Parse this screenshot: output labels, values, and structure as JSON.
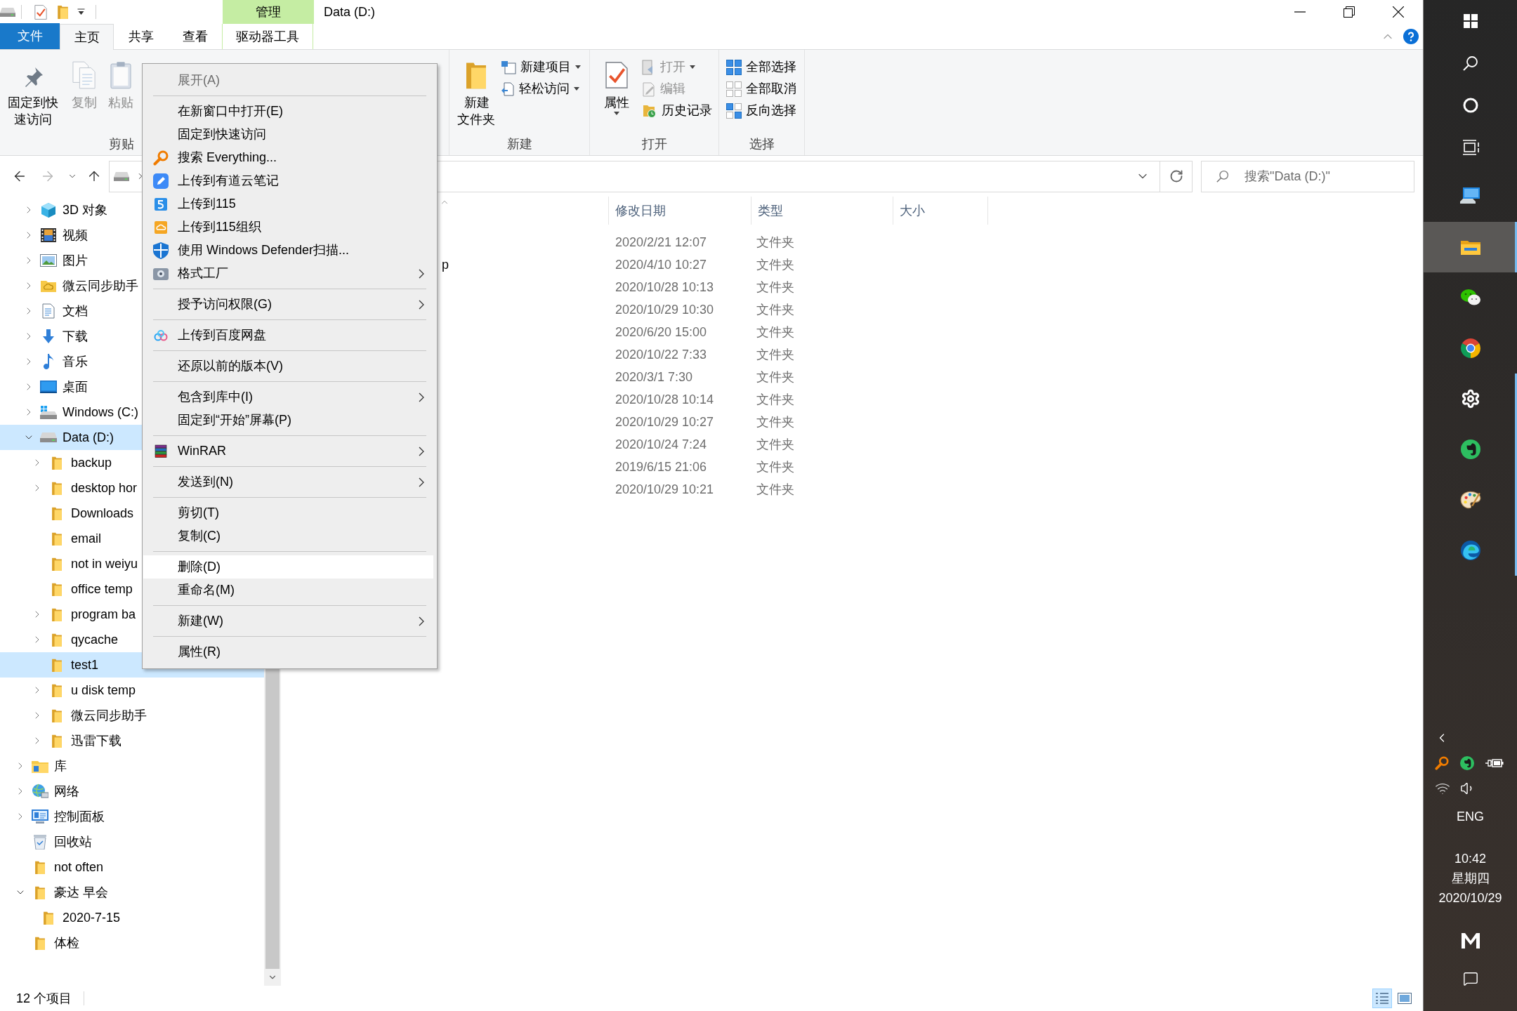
{
  "title_bar": {
    "contextual_group": "管理",
    "title": "Data (D:)"
  },
  "ribbon_tabs": [
    {
      "label": "文件",
      "kind": "file_menu",
      "selected": false
    },
    {
      "label": "主页",
      "kind": "tab",
      "selected": true
    },
    {
      "label": "共享",
      "kind": "tab",
      "selected": false
    },
    {
      "label": "查看",
      "kind": "tab",
      "selected": false
    },
    {
      "label": "驱动器工具",
      "kind": "contextual",
      "selected": false
    }
  ],
  "ribbon": {
    "groups": [
      {
        "label": "剪贴",
        "large_buttons": [
          {
            "label": "固定到快速访问",
            "disabled": false,
            "dropdown": false
          },
          {
            "label": "复制",
            "disabled": true,
            "dropdown": false
          },
          {
            "label": "粘贴",
            "disabled": true,
            "dropdown": false
          }
        ]
      },
      {
        "label": "新建",
        "large_buttons": [
          {
            "label": "新建文件夹",
            "disabled": false,
            "dropdown": false
          }
        ],
        "small_buttons": [
          {
            "label": "新建项目",
            "disabled": false,
            "dropdown": true
          },
          {
            "label": "轻松访问",
            "disabled": false,
            "dropdown": true
          }
        ]
      },
      {
        "label": "打开",
        "large_buttons": [
          {
            "label": "属性",
            "disabled": false,
            "dropdown": true
          }
        ],
        "small_buttons": [
          {
            "label": "打开",
            "disabled": true,
            "dropdown": true
          },
          {
            "label": "编辑",
            "disabled": true,
            "dropdown": false
          },
          {
            "label": "历史记录",
            "disabled": false,
            "dropdown": false
          }
        ]
      },
      {
        "label": "选择",
        "small_buttons": [
          {
            "label": "全部选择",
            "disabled": false,
            "dropdown": false
          },
          {
            "label": "全部取消",
            "disabled": false,
            "dropdown": false
          },
          {
            "label": "反向选择",
            "disabled": false,
            "dropdown": false
          }
        ]
      }
    ]
  },
  "search": {
    "placeholder": "搜索\"Data (D:)\""
  },
  "nav_pane": {
    "items": [
      {
        "label": "3D 对象",
        "kind": "branch",
        "expanded": false,
        "selected": false
      },
      {
        "label": "视频",
        "kind": "branch",
        "expanded": false,
        "selected": false
      },
      {
        "label": "图片",
        "kind": "branch",
        "expanded": false,
        "selected": false
      },
      {
        "label": "微云同步助手",
        "kind": "branch",
        "expanded": false,
        "selected": false
      },
      {
        "label": "文档",
        "kind": "branch",
        "expanded": false,
        "selected": false
      },
      {
        "label": "下载",
        "kind": "branch",
        "expanded": false,
        "selected": false
      },
      {
        "label": "音乐",
        "kind": "branch",
        "expanded": false,
        "selected": false
      },
      {
        "label": "桌面",
        "kind": "branch",
        "expanded": false,
        "selected": false
      },
      {
        "label": "Windows (C:)",
        "kind": "branch",
        "expanded": false,
        "selected": false
      },
      {
        "label": "Data (D:)",
        "kind": "branch",
        "expanded": true,
        "selected": true,
        "children": [
          {
            "label": "backup",
            "kind": "branch",
            "expanded": false,
            "selected": false
          },
          {
            "label": "desktop hor",
            "kind": "branch",
            "expanded": false,
            "selected": false
          },
          {
            "label": "Downloads",
            "kind": "leaf",
            "selected": false
          },
          {
            "label": "email",
            "kind": "leaf",
            "selected": false
          },
          {
            "label": "not in weiyu",
            "kind": "leaf",
            "selected": false
          },
          {
            "label": "office temp",
            "kind": "leaf",
            "selected": false
          },
          {
            "label": "program ba",
            "kind": "branch",
            "expanded": false,
            "selected": false
          },
          {
            "label": "qycache",
            "kind": "branch",
            "expanded": false,
            "selected": false
          },
          {
            "label": "test1",
            "kind": "leaf",
            "selected": true
          },
          {
            "label": "u disk temp",
            "kind": "branch",
            "expanded": false,
            "selected": false
          },
          {
            "label": "微云同步助手",
            "kind": "branch",
            "expanded": false,
            "selected": false
          },
          {
            "label": "迅雷下载",
            "kind": "branch",
            "expanded": false,
            "selected": false
          }
        ]
      }
    ],
    "root_items": [
      {
        "label": "库",
        "kind": "branch",
        "expanded": false,
        "selected": false
      },
      {
        "label": "网络",
        "kind": "branch",
        "expanded": false,
        "selected": false
      },
      {
        "label": "控制面板",
        "kind": "branch",
        "expanded": false,
        "selected": false
      },
      {
        "label": "回收站",
        "kind": "leaf",
        "selected": false
      },
      {
        "label": "not often",
        "kind": "leaf",
        "selected": false
      },
      {
        "label": "豪达 早会",
        "kind": "branch",
        "expanded": true,
        "selected": false,
        "children": [
          {
            "label": "2020-7-15",
            "kind": "leaf",
            "selected": false
          }
        ]
      },
      {
        "label": "体检",
        "kind": "leaf",
        "selected": false
      }
    ]
  },
  "file_list": {
    "columns": [
      {
        "label": "修改日期"
      },
      {
        "label": "类型"
      },
      {
        "label": "大小"
      }
    ],
    "rows": [
      {
        "date": "2020/2/21 12:07",
        "type": "文件夹"
      },
      {
        "name": "p",
        "date": "2020/4/10 10:27",
        "type": "文件夹"
      },
      {
        "date": "2020/10/28 10:13",
        "type": "文件夹"
      },
      {
        "date": "2020/10/29 10:30",
        "type": "文件夹"
      },
      {
        "date": "2020/6/20 15:00",
        "type": "文件夹"
      },
      {
        "date": "2020/10/22 7:33",
        "type": "文件夹"
      },
      {
        "date": "2020/3/1 7:30",
        "type": "文件夹"
      },
      {
        "date": "2020/10/28 10:14",
        "type": "文件夹"
      },
      {
        "date": "2020/10/29 10:27",
        "type": "文件夹"
      },
      {
        "date": "2020/10/24 7:24",
        "type": "文件夹"
      },
      {
        "date": "2019/6/15 21:06",
        "type": "文件夹"
      },
      {
        "date": "2020/10/29 10:21",
        "type": "文件夹"
      }
    ]
  },
  "status_bar": {
    "item_count": "12 个项目",
    "view_buttons": [
      {
        "selected": true
      },
      {
        "selected": false
      }
    ]
  },
  "context_menu": {
    "sections": [
      {
        "items": [
          {
            "label": "展开(A)",
            "disabled": true,
            "hovered": false,
            "submenu": false
          }
        ]
      },
      {
        "items": [
          {
            "label": "在新窗口中打开(E)",
            "disabled": false,
            "hovered": false,
            "submenu": false
          },
          {
            "label": "固定到快速访问",
            "disabled": false,
            "hovered": false,
            "submenu": false
          },
          {
            "label": "搜索 Everything...",
            "disabled": false,
            "hovered": false,
            "submenu": false
          },
          {
            "label": "上传到有道云笔记",
            "disabled": false,
            "hovered": false,
            "submenu": false
          },
          {
            "label": "上传到115",
            "disabled": false,
            "hovered": false,
            "submenu": false
          },
          {
            "label": "上传到115组织",
            "disabled": false,
            "hovered": false,
            "submenu": false
          },
          {
            "label": "使用 Windows Defender扫描...",
            "disabled": false,
            "hovered": false,
            "submenu": false
          },
          {
            "label": "格式工厂",
            "disabled": false,
            "hovered": false,
            "submenu": true
          }
        ]
      },
      {
        "items": [
          {
            "label": "授予访问权限(G)",
            "disabled": false,
            "hovered": false,
            "submenu": true
          }
        ]
      },
      {
        "items": [
          {
            "label": "上传到百度网盘",
            "disabled": false,
            "hovered": false,
            "submenu": false
          }
        ]
      },
      {
        "items": [
          {
            "label": "还原以前的版本(V)",
            "disabled": false,
            "hovered": false,
            "submenu": false
          }
        ]
      },
      {
        "items": [
          {
            "label": "包含到库中(I)",
            "disabled": false,
            "hovered": false,
            "submenu": true
          },
          {
            "label": "固定到“开始”屏幕(P)",
            "disabled": false,
            "hovered": false,
            "submenu": false
          }
        ]
      },
      {
        "items": [
          {
            "label": "WinRAR",
            "disabled": false,
            "hovered": false,
            "submenu": true
          }
        ]
      },
      {
        "items": [
          {
            "label": "发送到(N)",
            "disabled": false,
            "hovered": false,
            "submenu": true
          }
        ]
      },
      {
        "items": [
          {
            "label": "剪切(T)",
            "disabled": false,
            "hovered": false,
            "submenu": false
          },
          {
            "label": "复制(C)",
            "disabled": false,
            "hovered": false,
            "submenu": false
          }
        ]
      },
      {
        "items": [
          {
            "label": "删除(D)",
            "disabled": false,
            "hovered": true,
            "submenu": false
          },
          {
            "label": "重命名(M)",
            "disabled": false,
            "hovered": false,
            "submenu": false
          }
        ]
      },
      {
        "items": [
          {
            "label": "新建(W)",
            "disabled": false,
            "hovered": false,
            "submenu": true
          }
        ]
      },
      {
        "items": [
          {
            "label": "属性(R)",
            "disabled": false,
            "hovered": false,
            "submenu": false
          }
        ]
      }
    ]
  },
  "taskbar": {
    "apps": [
      {
        "running": false,
        "active": false
      },
      {
        "running": true,
        "active": true
      },
      {
        "running": false,
        "active": false
      },
      {
        "running": false,
        "active": false
      },
      {
        "running": true,
        "active": false
      },
      {
        "running": true,
        "active": false
      },
      {
        "running": true,
        "active": false
      },
      {
        "running": true,
        "active": false
      }
    ],
    "tray": {
      "input_language": "ENG",
      "time": "10:42",
      "weekday": "星期四",
      "date": "2020/10/29"
    }
  }
}
